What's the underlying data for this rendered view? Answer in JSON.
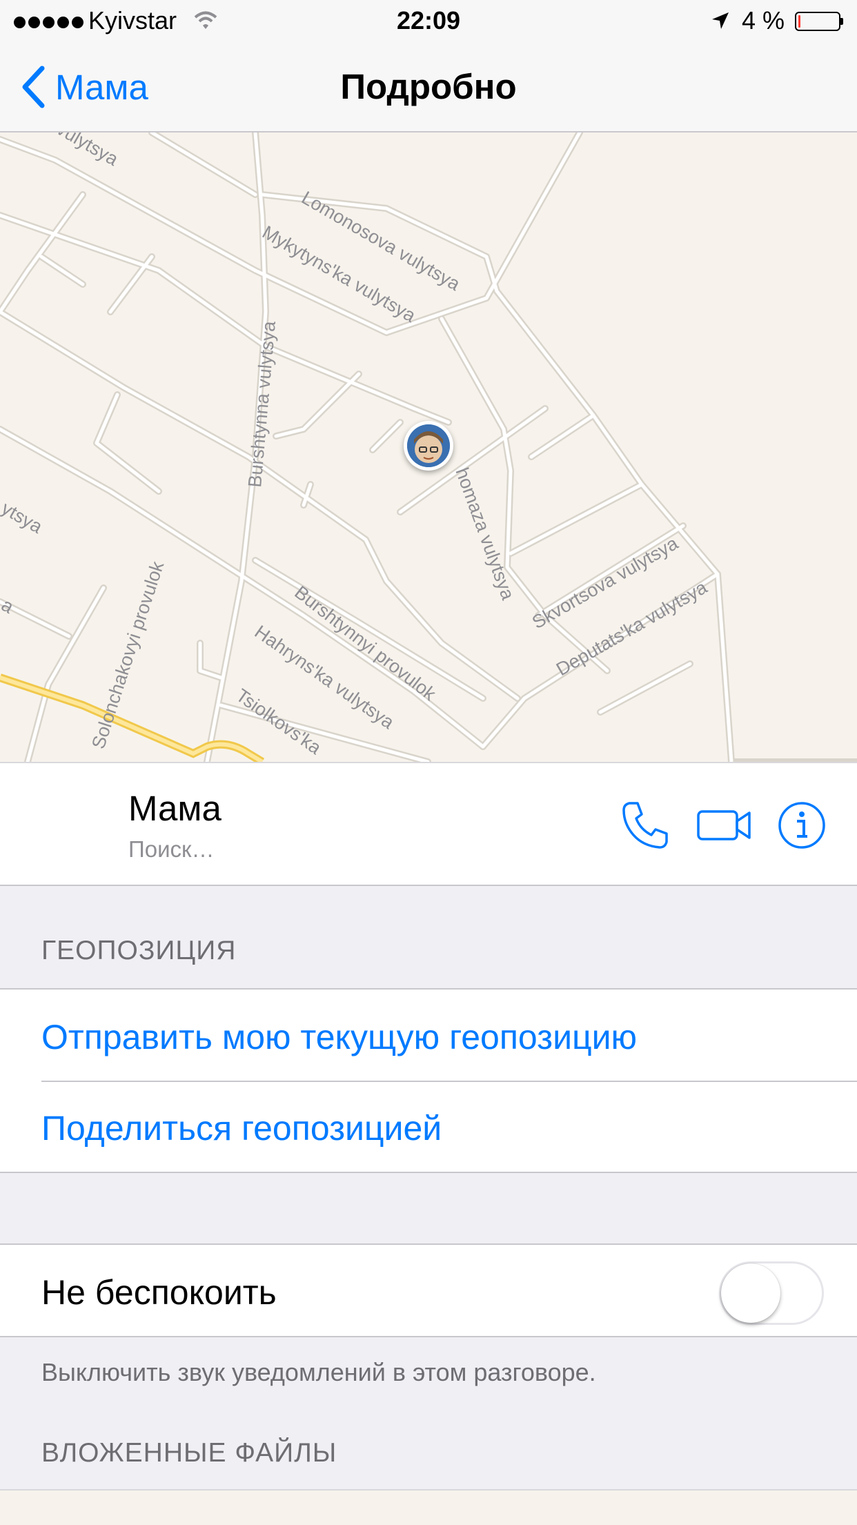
{
  "status_bar": {
    "carrier": "Kyivstar",
    "time": "22:09",
    "battery_percent": "4 %"
  },
  "nav": {
    "back_label": "Мама",
    "title": "Подробно"
  },
  "map": {
    "streets": [
      "Lomonosova vulytsya",
      "Mykytyns'ka vulytsya",
      "Burshtynna vulytsya",
      "Skvortsova vulytsya",
      "Deputats'ka vulytsya",
      "Burshtynnyi provulok",
      "Hahryns'ka vulytsya",
      "Tsiolkovs'ka",
      "Solonchakovyi provulok",
      "homaza vulytsya",
      "vulytsya",
      "ytsya",
      "a"
    ]
  },
  "contact": {
    "name": "Мама",
    "status": "Поиск…",
    "phone_icon": "phone-icon",
    "video_icon": "video-camera-icon",
    "info_icon": "info-icon"
  },
  "location_section": {
    "header": "ГЕОПОЗИЦИЯ",
    "send_current": "Отправить мою текущую геопозицию",
    "share": "Поделиться геопозицией"
  },
  "dnd": {
    "label": "Не беспокоить",
    "enabled": false,
    "footer": "Выключить звук уведомлений в этом разговоре."
  },
  "attachments": {
    "header": "ВЛОЖЕННЫЕ ФАЙЛЫ"
  },
  "colors": {
    "accent": "#007aff",
    "battery_low": "#ff3b30"
  }
}
